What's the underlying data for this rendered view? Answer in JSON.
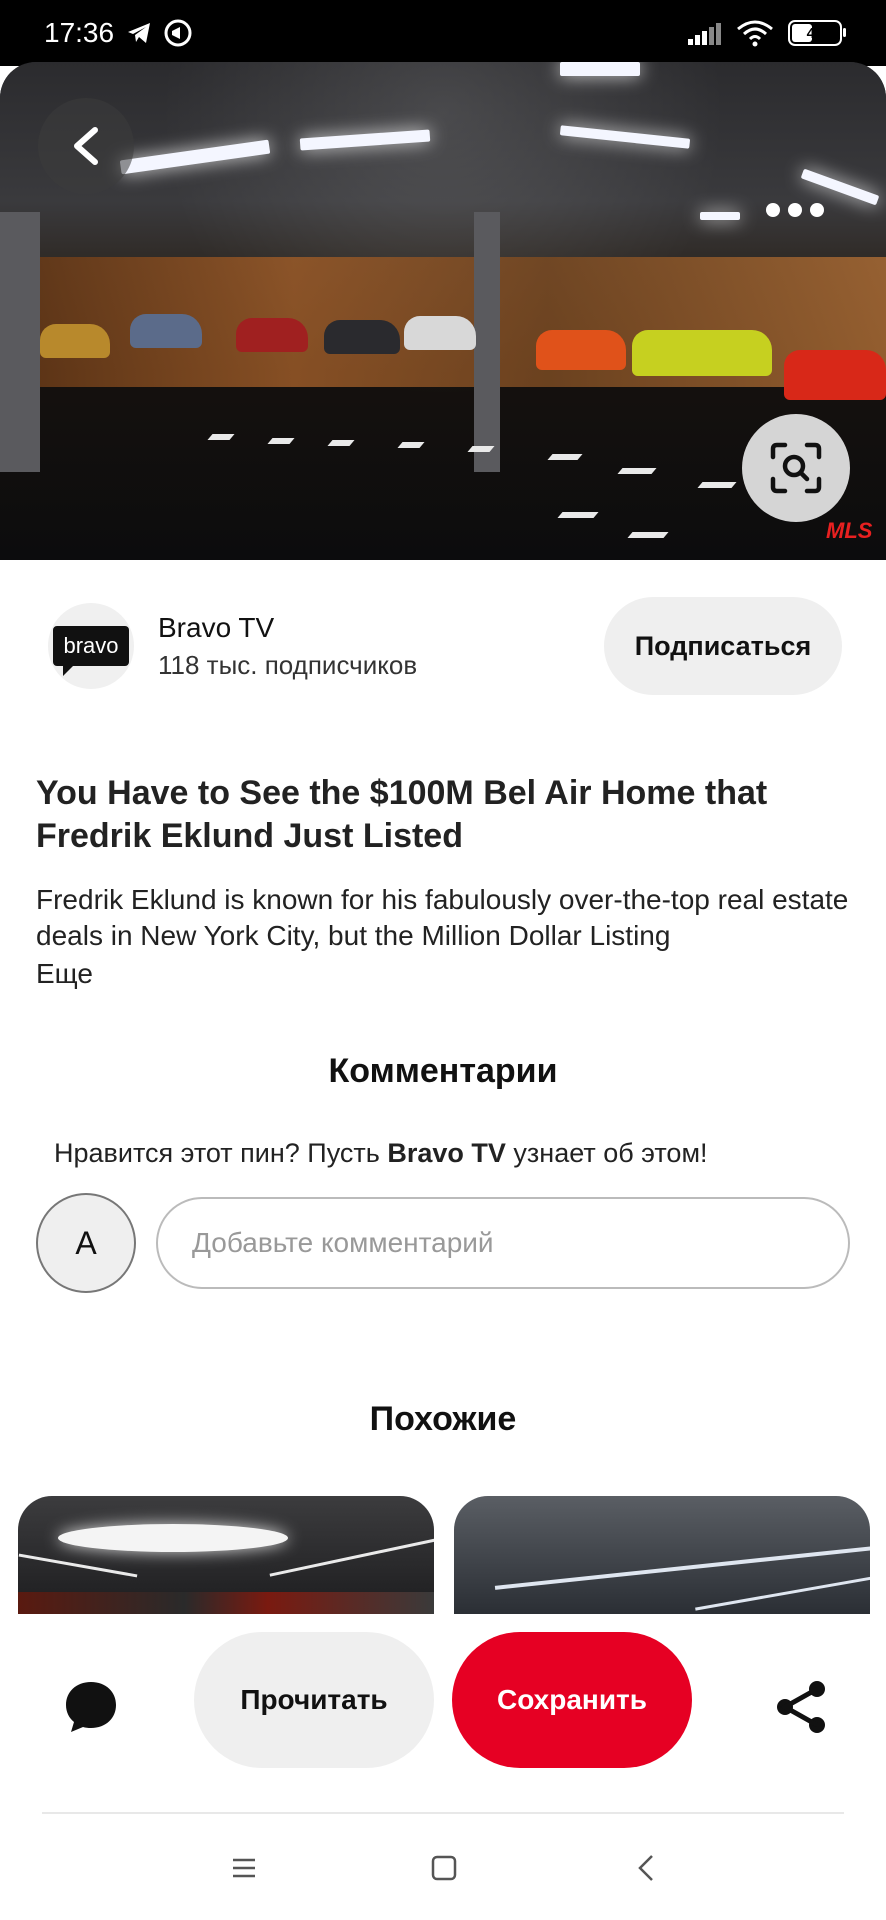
{
  "status_bar": {
    "time": "17:36",
    "battery": "45",
    "icons": [
      "telegram-icon",
      "notification-icon",
      "signal-icon",
      "wifi-icon",
      "battery-icon"
    ]
  },
  "hero": {
    "watermark": "MLS",
    "back_icon": "back-arrow-icon",
    "more_icon": "more-dots-icon",
    "lens_icon": "visual-search-icon"
  },
  "profile": {
    "logo_text": "bravo",
    "name": "Bravo TV",
    "subscribers": "118 тыс. подписчиков",
    "subscribe_label": "Подписаться"
  },
  "pin": {
    "title": "You Have to See the $100M Bel Air Home that Fredrik Eklund Just Listed",
    "description": "Fredrik Eklund is known for his fabulously over-the-top real estate deals in New York City, but the Million Dollar Listing",
    "more_label": "Еще"
  },
  "comments": {
    "title": "Комментарии",
    "prompt_before": "Нравится этот пин? Пусть ",
    "prompt_name": "Bravo TV",
    "prompt_after": " узнает об этом!",
    "avatar_letter": "A",
    "input_placeholder": "Добавьте комментарий"
  },
  "similar": {
    "title": "Похожие"
  },
  "actions": {
    "read_label": "Прочитать",
    "save_label": "Сохранить",
    "comment_icon": "comment-bubble-icon",
    "share_icon": "share-icon",
    "save_color": "#e60023"
  },
  "nav": {
    "icons": [
      "menu-icon",
      "home-square-icon",
      "back-chevron-icon"
    ]
  }
}
